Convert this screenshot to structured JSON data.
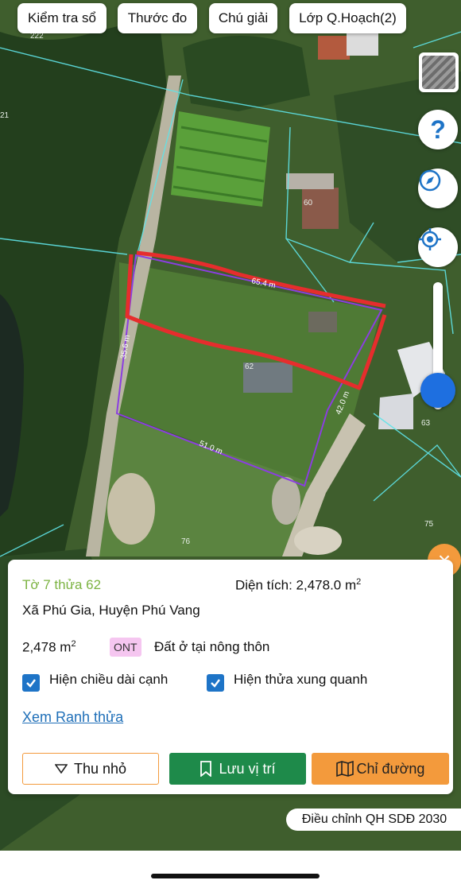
{
  "toolbar": {
    "check_book": "Kiểm tra sổ",
    "ruler": "Thước đo",
    "legend": "Chú giải",
    "planning_layer": "Lớp Q.Hoạch(2)"
  },
  "map": {
    "edge_labels": {
      "top": "65.4 m",
      "left": "35.6 m",
      "right": "42.0 m",
      "bottom": "51.0 m"
    },
    "parcel_numbers": [
      "222",
      "21",
      "60",
      "62",
      "63",
      "75",
      "76"
    ],
    "zoom_level": 0.85,
    "right_controls": [
      "layer-thumbnail",
      "help-icon",
      "compass-icon",
      "locate-icon"
    ]
  },
  "panel": {
    "sheet_parcel": "Tờ 7 thửa 62",
    "area_label": "Diện tích: 2,478.0 m",
    "area_sup": "2",
    "address": "Xã Phú Gia, Huyện Phú Vang",
    "area_short": "2,478 m",
    "area_short_sup": "2",
    "land_code": "ONT",
    "land_use": "Đất ở tại nông thôn",
    "show_edge_length": "Hiện chiều dài cạnh",
    "show_nearby": "Hiện thửa xung quanh",
    "view_boundary": "Xem Ranh thửa",
    "collapse": "Thu nhỏ",
    "save_location": "Lưu vị trí",
    "directions": "Chỉ đường"
  },
  "footer_badge": "Điều chỉnh QH SDĐ 2030",
  "colors": {
    "primary_green": "#1e8a4a",
    "orange": "#f39a3c",
    "accent_blue": "#1e74c7",
    "link_blue": "#1f6fb8",
    "title_green": "#7cb342",
    "ont_bg": "#f5c6f0"
  }
}
